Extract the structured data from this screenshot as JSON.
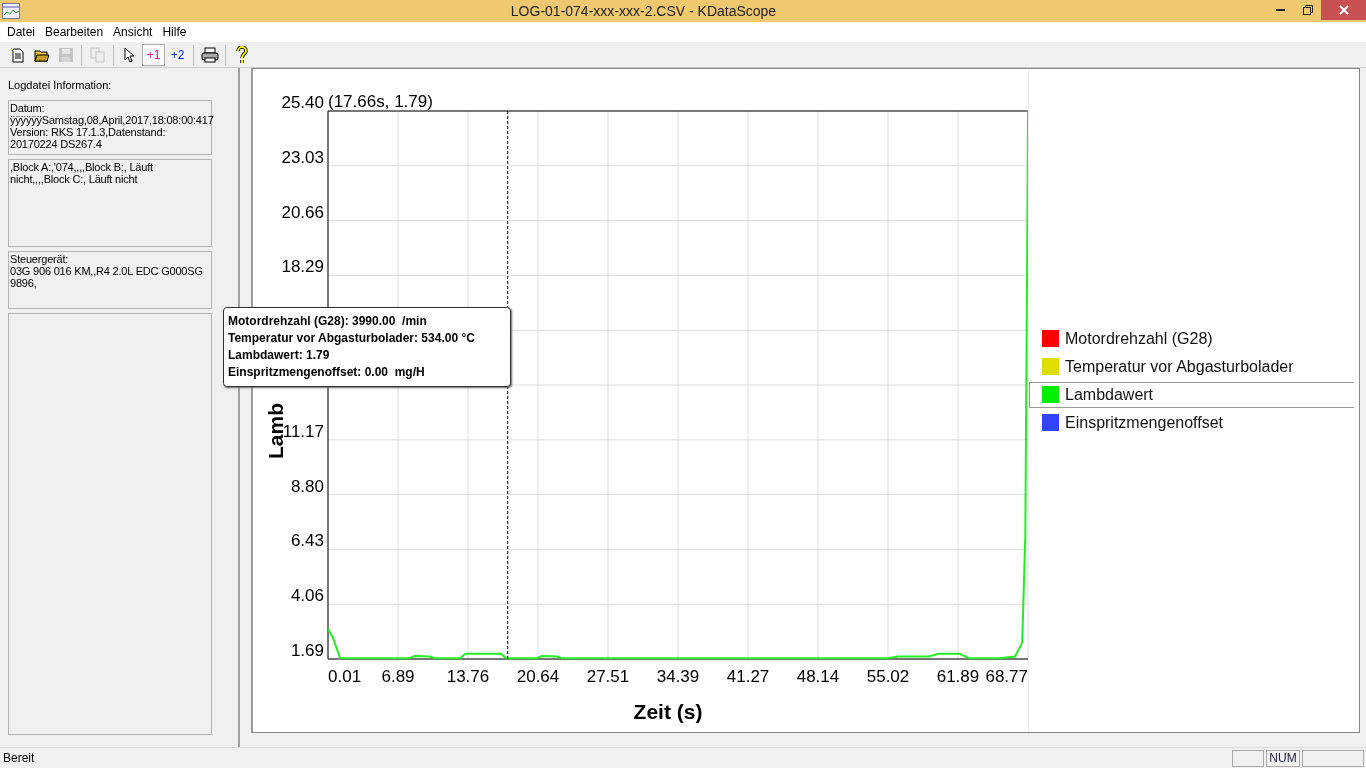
{
  "window": {
    "title": "LOG-01-074-xxx-xxx-2.CSV - KDataScope"
  },
  "menu": [
    "Datei",
    "Bearbeiten",
    "Ansicht",
    "Hilfe"
  ],
  "toolbar": [
    {
      "kind": "new",
      "disabled": false,
      "selected": false
    },
    {
      "kind": "open",
      "disabled": false,
      "selected": false
    },
    {
      "kind": "save",
      "disabled": true,
      "selected": false
    },
    {
      "kind": "sep"
    },
    {
      "kind": "copy",
      "disabled": true,
      "selected": false
    },
    {
      "kind": "sep"
    },
    {
      "kind": "pointer",
      "disabled": false,
      "selected": false
    },
    {
      "kind": "marker1",
      "label": "+1",
      "disabled": false,
      "selected": true
    },
    {
      "kind": "marker2",
      "label": "+2",
      "disabled": false,
      "selected": false
    },
    {
      "kind": "sep"
    },
    {
      "kind": "print",
      "disabled": false,
      "selected": false
    },
    {
      "kind": "sep"
    },
    {
      "kind": "help",
      "disabled": false,
      "selected": false
    }
  ],
  "sidebar": {
    "heading": "Logdatei Information:",
    "boxes": [
      {
        "lines": [
          "Datum:",
          "ÿÿÿÿÿÿSamstag,08,April,2017,18:08:00:417",
          "Version: RKS 17.1.3,Datenstand:",
          "20170224 DS267.4"
        ]
      },
      {
        "lines": [
          ",Block A:,'074,,,,Block B:, Läuft",
          "nicht,,,,Block C:, Läuft nicht"
        ]
      },
      {
        "lines": [
          "Steuergerät:",
          "03G 906 016 KM,,R4 2.0L EDC G000SG",
          "9896,"
        ]
      }
    ]
  },
  "chart": {
    "chart_data": {
      "type": "line",
      "xlabel": "Zeit (s)",
      "ylabel": "Lamb",
      "grid": true,
      "ref_lines": [
        {
          "axis": "x",
          "value": 17.66,
          "label": "(17.66s, 1.79)"
        }
      ],
      "x": [
        0.01,
        0.5,
        1.2,
        2,
        8,
        8.5,
        10,
        10.5,
        13,
        13.5,
        17,
        17.5,
        20.5,
        21,
        22.5,
        23,
        55,
        56,
        59,
        60,
        62,
        63,
        66,
        67.5,
        68.2,
        68.5,
        68.7,
        68.77
      ],
      "series": [
        {
          "color": "#22ee22",
          "values": [
            3.0,
            2.6,
            1.72,
            1.72,
            1.72,
            1.82,
            1.8,
            1.72,
            1.72,
            1.92,
            1.92,
            1.72,
            1.72,
            1.82,
            1.8,
            1.72,
            1.72,
            1.8,
            1.8,
            1.92,
            1.92,
            1.72,
            1.72,
            1.8,
            2.4,
            7.0,
            20.0,
            25.4
          ]
        }
      ],
      "xlim": [
        0.01,
        68.77
      ],
      "ylim": [
        1.69,
        25.4
      ],
      "xticks": [
        0.01,
        6.89,
        13.76,
        20.64,
        27.51,
        34.39,
        41.27,
        48.14,
        55.02,
        61.89,
        68.77
      ],
      "yticks": [
        {
          "value": 1.69,
          "label": "1.69"
        },
        {
          "value": 4.06,
          "label": "4.06"
        },
        {
          "value": 6.43,
          "label": "6.43"
        },
        {
          "value": 8.8,
          "label": "8.80"
        },
        {
          "value": 11.17,
          "label": "11.17"
        },
        {
          "value": 18.29,
          "label": "18.29"
        },
        {
          "value": 20.66,
          "label": "20.66"
        },
        {
          "value": 23.03,
          "label": "23.03"
        },
        {
          "value": 25.4,
          "label": "25.40"
        }
      ]
    }
  },
  "tooltip": {
    "lines": [
      "Motordrehzahl (G28): 3990.00  /min",
      "Temperatur vor Abgasturbolader: 534.00 °C",
      "Lambdawert: 1.79",
      "Einspritzmengenoffset: 0.00  mg/H"
    ]
  },
  "legend": [
    {
      "label": "Motordrehzahl (G28)",
      "color": "#ff0000",
      "selected": false
    },
    {
      "label": "Temperatur vor Abgasturbolader",
      "color": "#dddd00",
      "selected": false
    },
    {
      "label": "Lambdawert",
      "color": "#00ee00",
      "selected": true
    },
    {
      "label": "Einspritzmengenoffset",
      "color": "#3344ff",
      "selected": false
    }
  ],
  "status_bar": {
    "text": "Bereit",
    "panels": [
      "NUM"
    ]
  }
}
